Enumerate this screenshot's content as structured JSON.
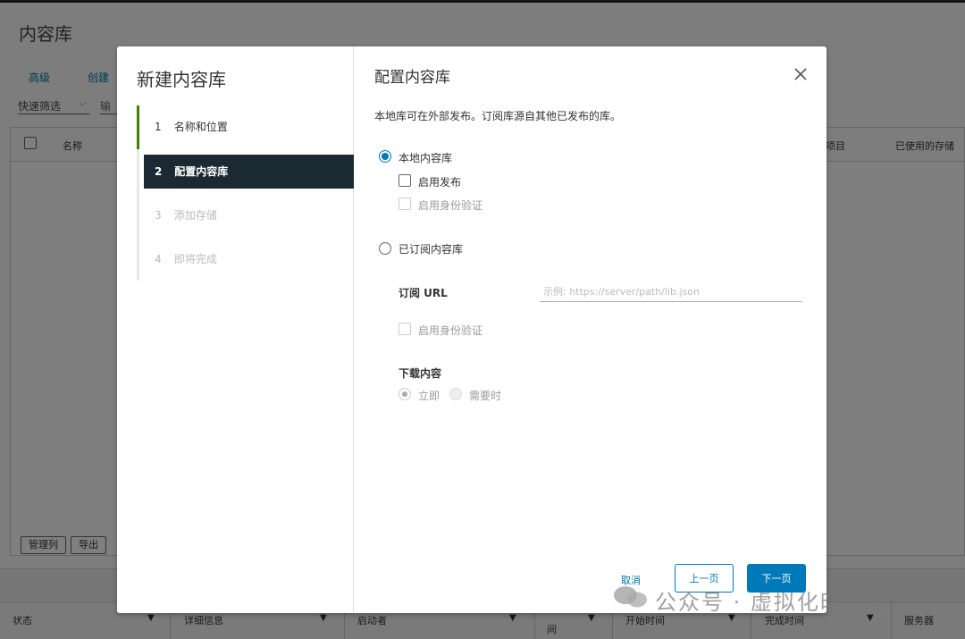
{
  "background": {
    "page_title": "内容库",
    "buttons": [
      "高级",
      "创建"
    ],
    "quick_filter": "快速筛选",
    "input_partial": "输",
    "grid_columns": [
      "名称",
      "项目",
      "已使用的存储"
    ],
    "footer_buttons": [
      "管理列",
      "导出"
    ],
    "bottom_columns": [
      "状态",
      "详细信息",
      "启动者",
      "间",
      "开始时间",
      "完成时间",
      "服务器"
    ]
  },
  "wizard": {
    "title": "新建内容库",
    "steps": [
      {
        "num": "1",
        "label": "名称和位置"
      },
      {
        "num": "2",
        "label": "配置内容库"
      },
      {
        "num": "3",
        "label": "添加存储"
      },
      {
        "num": "4",
        "label": "即将完成"
      }
    ]
  },
  "pane": {
    "title": "配置内容库",
    "description": "本地库可在外部发布。订阅库源自其他已发布的库。",
    "local_library": "本地内容库",
    "enable_publish": "启用发布",
    "enable_auth": "启用身份验证",
    "subscribed_library": "已订阅内容库",
    "subscription_url_label": "订阅 URL",
    "subscription_url_placeholder": "示例: https://server/path/lib.json",
    "enable_auth_sub": "启用身份验证",
    "download_content": "下载内容",
    "immediately": "立即",
    "when_needed": "需要时"
  },
  "footer": {
    "cancel": "取消",
    "back": "上一页",
    "next": "下一页"
  },
  "watermark": "公众号 · 虚拟化时代君",
  "colors": {
    "accent": "#0079b8",
    "active_step_bg": "#1b2a32",
    "done_step_rail": "#3c8500"
  }
}
